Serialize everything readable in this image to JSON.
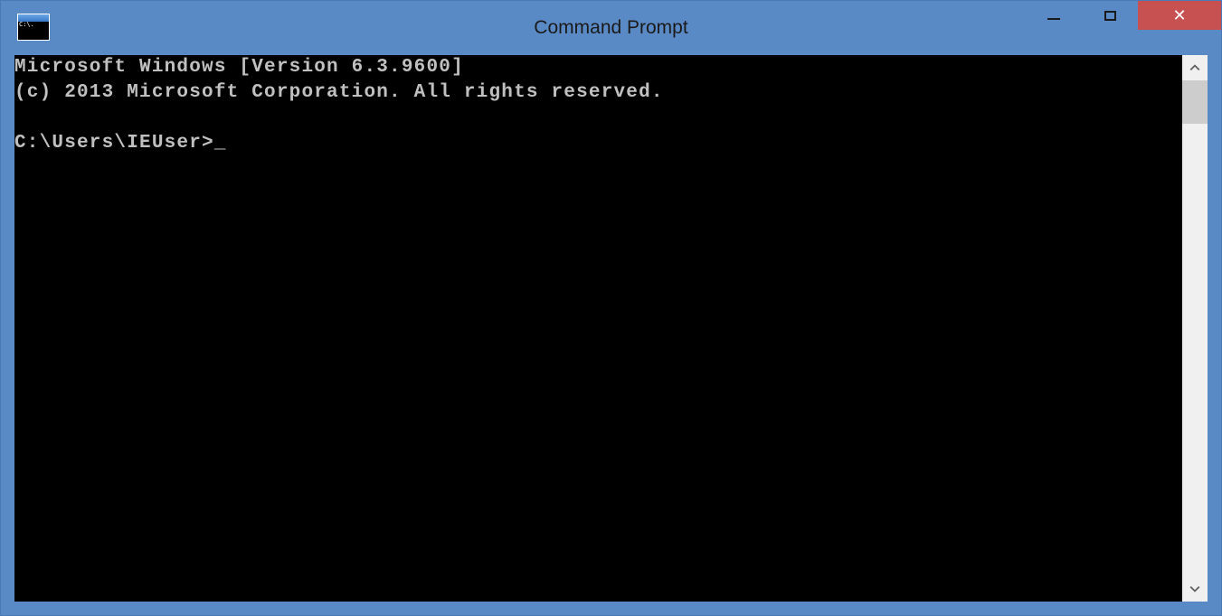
{
  "window": {
    "title": "Command Prompt",
    "app_icon_text": "C:\\."
  },
  "console": {
    "line1": "Microsoft Windows [Version 6.3.9600]",
    "line2": "(c) 2013 Microsoft Corporation. All rights reserved.",
    "blank": "",
    "prompt": "C:\\Users\\IEUser>"
  }
}
